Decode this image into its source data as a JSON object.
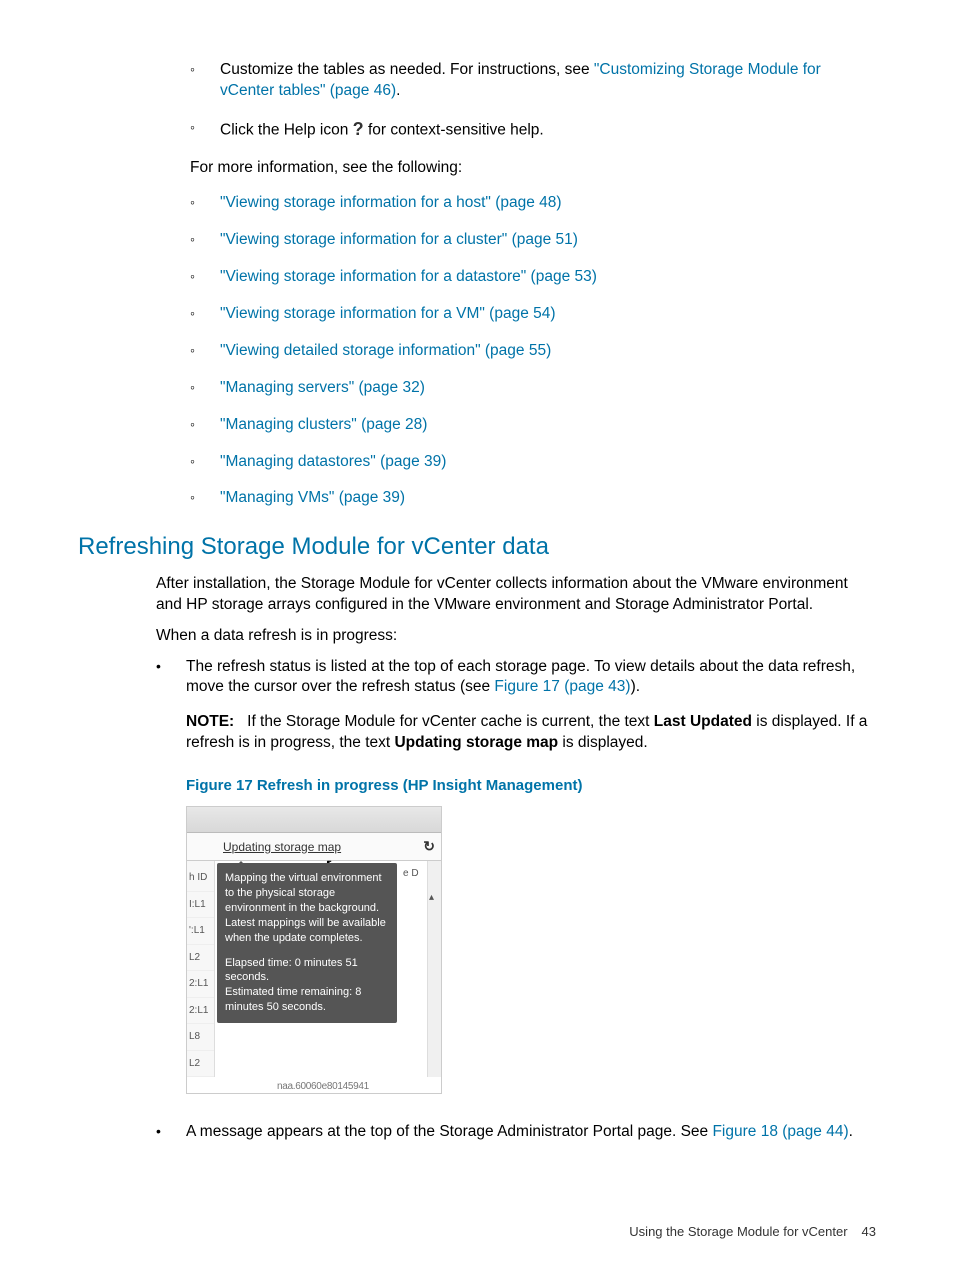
{
  "top": {
    "customize_pre": "Customize the tables as needed. For instructions, see ",
    "customize_link": "\"Customizing Storage Module for vCenter tables\" (page 46)",
    "customize_post": ".",
    "help_pre": "Click the Help icon ",
    "help_post": " for context-sensitive help."
  },
  "intro2": "For more information, see the following:",
  "links": [
    "\"Viewing storage information for a host\" (page 48)",
    "\"Viewing storage information for a cluster\" (page 51)",
    "\"Viewing storage information for a datastore\" (page 53)",
    "\"Viewing storage information for a VM\" (page 54)",
    "\"Viewing detailed storage information\" (page 55)",
    "\"Managing servers\" (page 32)",
    "\"Managing clusters\" (page 28)",
    "\"Managing datastores\" (page 39)",
    "\"Managing VMs\" (page 39)"
  ],
  "section_heading": "Refreshing Storage Module for vCenter data",
  "p1": "After installation, the Storage Module for vCenter collects information about the VMware environment and HP storage arrays configured in the VMware environment and Storage Administrator Portal.",
  "p2": "When a data refresh is in progress:",
  "b1_pre": "The refresh status is listed at the top of each storage page. To view details about the data refresh, move the cursor over the refresh status (see ",
  "b1_link": "Figure 17 (page 43)",
  "b1_post": ").",
  "note_label": "NOTE:",
  "note_text1": "If the Storage Module for vCenter cache is current, the text ",
  "note_bold1": "Last Updated",
  "note_text2": " is displayed. If a refresh is in progress, the text ",
  "note_bold2": "Updating storage map",
  "note_text3": " is displayed.",
  "fig_caption": "Figure 17 Refresh in progress (HP Insight Management)",
  "shot": {
    "bar_text": "Updating storage map",
    "leftcol": [
      "h ID",
      "I:L1",
      "':L1",
      "L2",
      "2:L1",
      "2:L1",
      "L8",
      "L2"
    ],
    "right_edge": "e D",
    "tooltip_p1": "Mapping the virtual environment to the physical storage environment in the background.",
    "tooltip_p2": "Latest mappings will be available when the update completes.",
    "tooltip_p3": "Elapsed time: 0 minutes 51 seconds.",
    "tooltip_p4": "Estimated time remaining: 8 minutes 50 seconds.",
    "naa": "naa.60060e80145941"
  },
  "b2_pre": "A message appears at the top of the Storage Administrator Portal page. See ",
  "b2_link": "Figure 18 (page 44)",
  "b2_post": ".",
  "footer_section": "Using the Storage Module for vCenter",
  "footer_page": "43"
}
